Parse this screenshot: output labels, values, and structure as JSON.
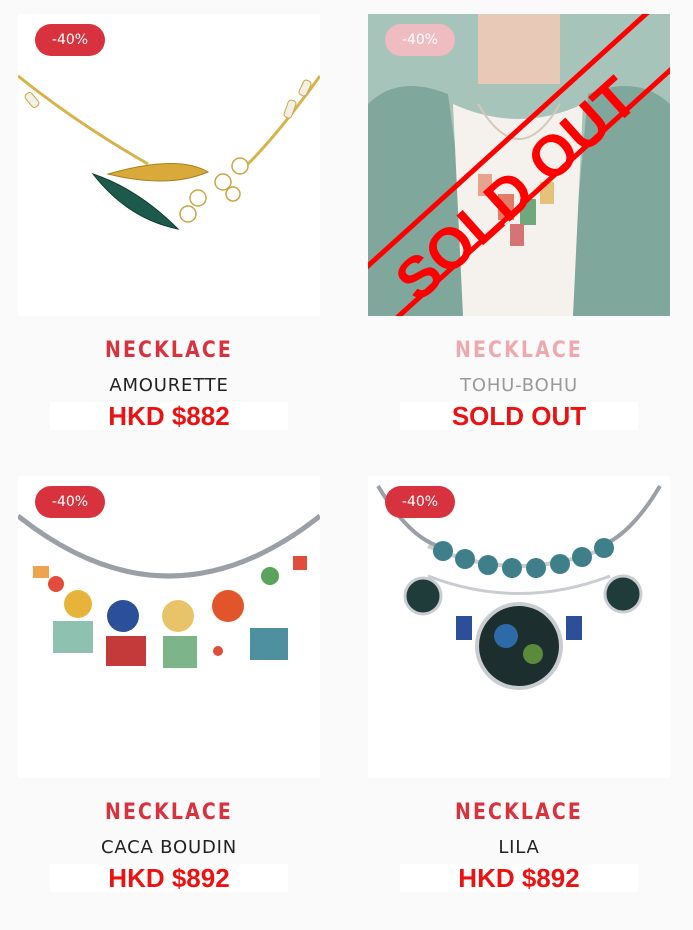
{
  "products": [
    {
      "discount": "-40%",
      "category": "NECKLACE",
      "name": "AMOURETTE",
      "price": "HKD $882",
      "sold_out": false
    },
    {
      "discount": "-40%",
      "category": "NECKLACE",
      "name": "TOHU-BOHU",
      "price": "SOLD OUT",
      "sold_out": true,
      "overlay_text": "SOLD OUT"
    },
    {
      "discount": "-40%",
      "category": "NECKLACE",
      "name": "CACA BOUDIN",
      "price": "HKD $892",
      "sold_out": false
    },
    {
      "discount": "-40%",
      "category": "NECKLACE",
      "name": "LILA",
      "price": "HKD $892",
      "sold_out": false
    }
  ],
  "colors": {
    "accent": "#d8323e",
    "price": "#ee1111",
    "soldout_band": "#ff0000",
    "jacket": "#7fa79c"
  }
}
